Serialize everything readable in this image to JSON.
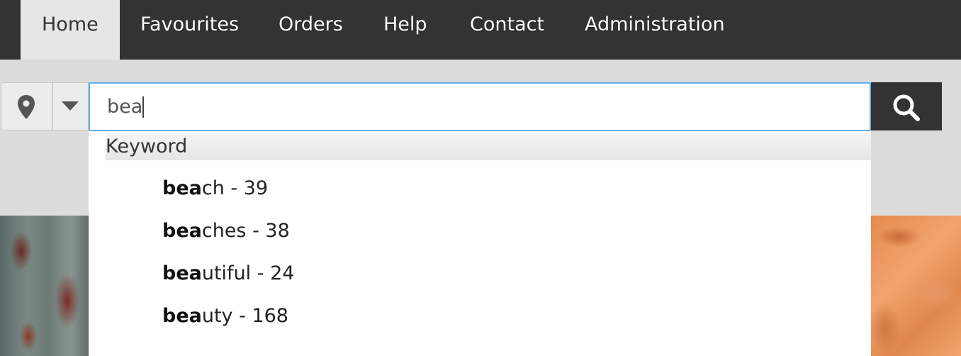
{
  "nav": {
    "items": [
      {
        "label": "Home",
        "active": true
      },
      {
        "label": "Favourites",
        "active": false
      },
      {
        "label": "Orders",
        "active": false
      },
      {
        "label": "Help",
        "active": false
      },
      {
        "label": "Contact",
        "active": false
      },
      {
        "label": "Administration",
        "active": false
      }
    ]
  },
  "search": {
    "location_icon": "map-pin-icon",
    "dropdown_icon": "caret-down-icon",
    "value": "bea",
    "button_icon": "search-icon"
  },
  "autocomplete": {
    "group_label": "Keyword",
    "query_prefix": "bea",
    "items": [
      {
        "match": "bea",
        "rest": "ch - 39"
      },
      {
        "match": "bea",
        "rest": "ches - 38"
      },
      {
        "match": "bea",
        "rest": "utiful - 24"
      },
      {
        "match": "bea",
        "rest": "uty - 168"
      }
    ]
  },
  "colors": {
    "nav_bg": "#333333",
    "nav_active_bg": "#e6e6e6",
    "focus_border": "#66afe9",
    "search_button_bg": "#333333"
  }
}
